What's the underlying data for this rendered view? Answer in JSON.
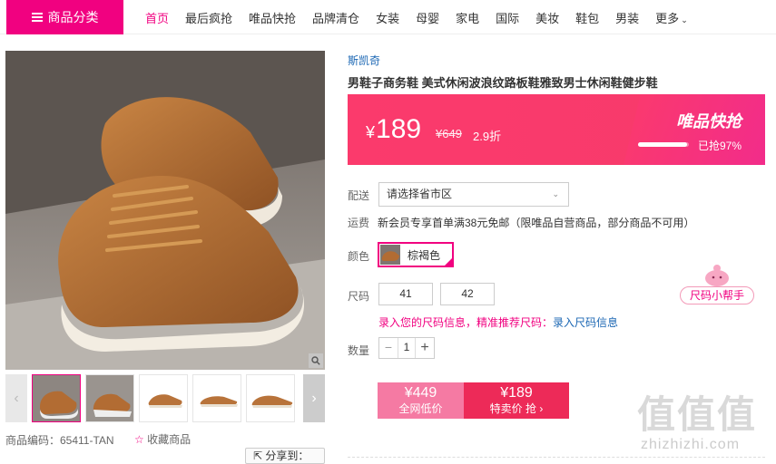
{
  "nav": {
    "category_button": "商品分类",
    "items": [
      "首页",
      "最后疯抢",
      "唯品快抢",
      "品牌清仓",
      "女装",
      "母婴",
      "家电",
      "国际",
      "美妆",
      "鞋包",
      "男装"
    ],
    "more": "更多"
  },
  "product": {
    "brand": "斯凯奇",
    "title": "男鞋子商务鞋 美式休闲波浪纹路板鞋雅致男士休闲鞋健步鞋",
    "code_label": "商品编码：65411-TAN",
    "favorite": "收藏商品",
    "share": "分享到："
  },
  "price": {
    "current": "189",
    "currency": "¥",
    "original": "¥649",
    "discount": "2.9折",
    "flash_label": "唯品快抢",
    "sold_text": "已抢97%",
    "sold_percent": 97
  },
  "delivery": {
    "label": "配送",
    "placeholder": "请选择省市区"
  },
  "shipping": {
    "label": "运费",
    "text": "新会员专享首单满38元免邮（限唯品自营商品，部分商品不可用）"
  },
  "color": {
    "label": "颜色",
    "options": [
      "棕褐色"
    ]
  },
  "size": {
    "label": "尺码",
    "options": [
      "41",
      "42"
    ],
    "hint_pink": "录入您的尺码信息，精准推荐尺码：",
    "hint_link": "录入尺码信息",
    "helper": "尺码小帮手"
  },
  "quantity": {
    "label": "数量",
    "value": "1",
    "minus": "−",
    "plus": "+"
  },
  "buy": {
    "left_price": "¥449",
    "left_sub": "全网低价",
    "right_price": "¥189",
    "right_sub": "特卖价 抢 ›"
  },
  "watermark": {
    "chars": "值值值",
    "url": "zhizhizhi.com"
  },
  "colors": {
    "brand_pink": "#f10180",
    "banner": "#fb3a6c",
    "link_blue": "#1a66b3"
  }
}
